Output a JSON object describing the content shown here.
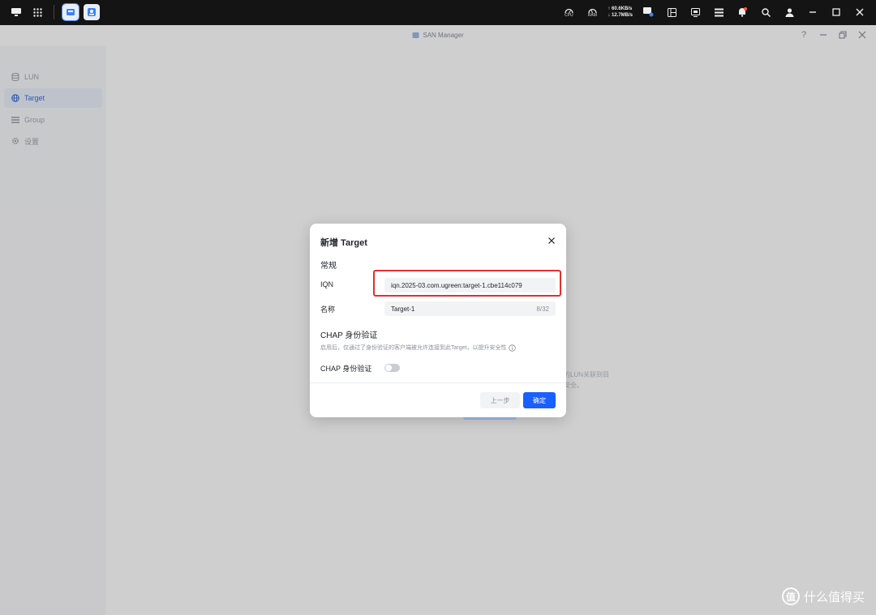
{
  "taskbar": {
    "cpu_label": "CPU",
    "ram_label": "RAM",
    "upload_speed": "↑ 60.6KB/s",
    "download_speed": "↓ 12.7MB/s"
  },
  "window": {
    "title": "SAN Manager",
    "help_label": "?"
  },
  "sidebar": {
    "items": [
      {
        "label": "LUN",
        "icon": "database-icon"
      },
      {
        "label": "Target",
        "icon": "globe-icon",
        "active": true
      },
      {
        "label": "Group",
        "icon": "list-icon"
      },
      {
        "label": "设置",
        "icon": "gear-icon"
      }
    ]
  },
  "background_hint": {
    "line1": "的LUN关联到目",
    "line2": "安全。"
  },
  "dialog": {
    "title": "新增 Target",
    "general_section": "常规",
    "iqn_label": "IQN",
    "iqn_value": "iqn.2025-03.com.ugreen:target-1.cbe114c079",
    "name_label": "名称",
    "name_value": "Target-1",
    "name_count": "8/32",
    "chap_section": "CHAP 身份验证",
    "chap_hint": "启用后，仅通过了身份验证的客户端被允许连接到此Target，以提升安全性",
    "chap_toggle_label": "CHAP 身份验证",
    "chap_enabled": false,
    "prev_button": "上一步",
    "ok_button": "确定"
  },
  "watermark": {
    "logo": "值",
    "text": "什么值得买"
  },
  "colors": {
    "accent": "#1a5fff",
    "highlight_border": "#e03131",
    "taskbar_bg": "#141414"
  }
}
